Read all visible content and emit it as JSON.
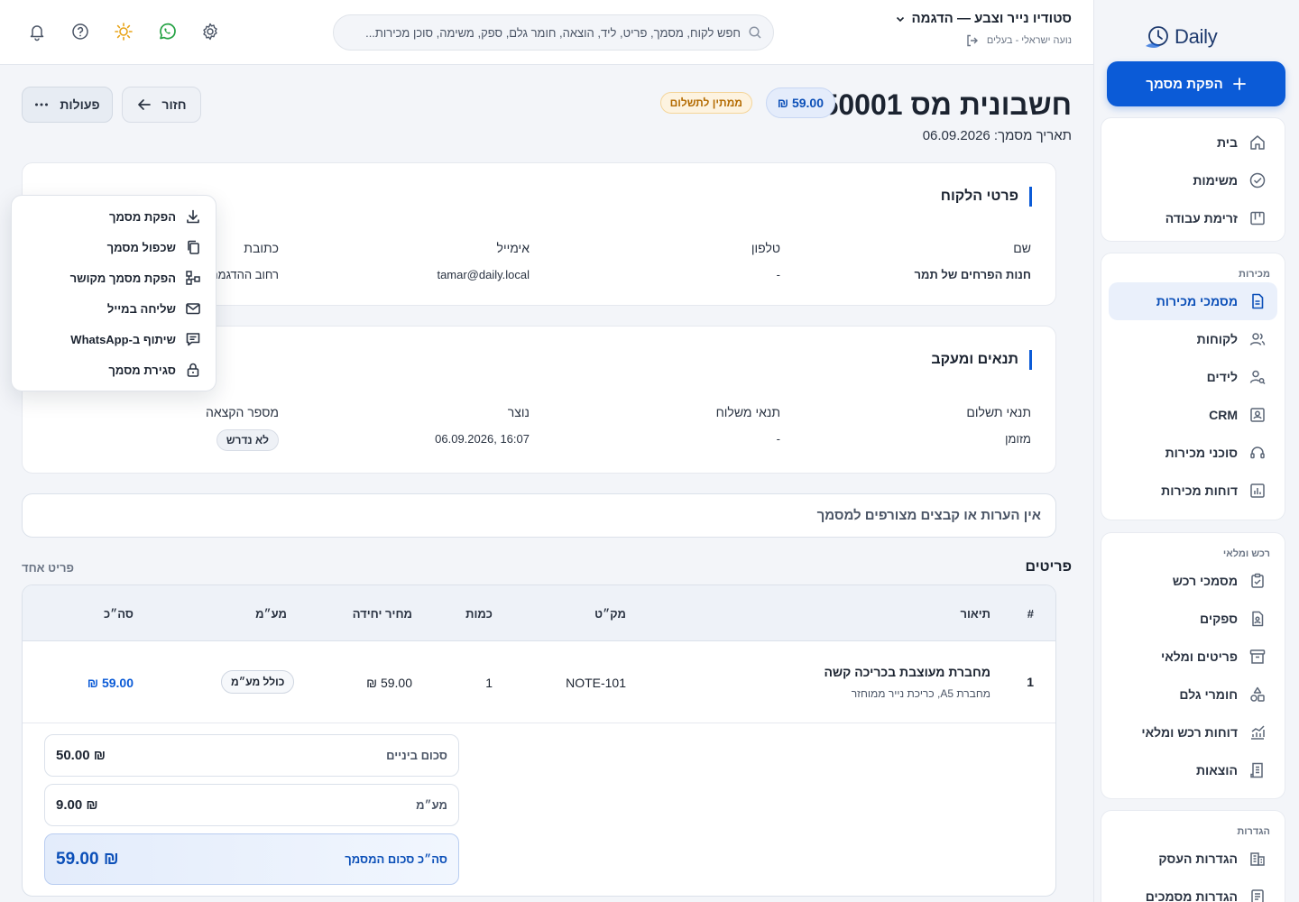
{
  "sidebar": {
    "logo_text": "Daily",
    "new_doc_label": "הפקת מסמך",
    "top_items": [
      {
        "label": "בית",
        "icon": "home-icon"
      },
      {
        "label": "משימות",
        "icon": "check-circle-icon"
      },
      {
        "label": "זרימת עבודה",
        "icon": "kanban-icon"
      }
    ],
    "sales_section": "מכירות",
    "sales_items": [
      {
        "label": "מסמכי מכירות",
        "icon": "document-icon",
        "active": true
      },
      {
        "label": "לקוחות",
        "icon": "users-icon"
      },
      {
        "label": "לידים",
        "icon": "user-search-icon"
      },
      {
        "label": "CRM",
        "icon": "contact-card-icon"
      },
      {
        "label": "סוכני מכירות",
        "icon": "headset-icon"
      },
      {
        "label": "דוחות מכירות",
        "icon": "bar-chart-icon"
      }
    ],
    "stock_section": "רכש ומלאי",
    "stock_items": [
      {
        "label": "מסמכי רכש",
        "icon": "clipboard-icon"
      },
      {
        "label": "ספקים",
        "icon": "supplier-icon"
      },
      {
        "label": "פריטים ומלאי",
        "icon": "archive-icon"
      },
      {
        "label": "חומרי גלם",
        "icon": "shapes-icon"
      },
      {
        "label": "דוחות רכש ומלאי",
        "icon": "line-chart-icon"
      },
      {
        "label": "הוצאות",
        "icon": "receipt-icon"
      }
    ],
    "settings_section": "הגדרות",
    "settings_items": [
      {
        "label": "הגדרות העסק",
        "icon": "building-icon"
      },
      {
        "label": "הגדרות מסמכים",
        "icon": "document-settings-icon"
      }
    ]
  },
  "header": {
    "business_name": "סטודיו נייר וצבע — הדגמה",
    "user_line": "נועה ישראלי - בעלים",
    "search_placeholder": "חפש לקוח, מסמך, פריט, ליד, הוצאה, חומר גלם, ספק, משימה, סוכן מכירות...",
    "icons": [
      "bell-icon",
      "help-icon",
      "sun-icon",
      "whatsapp-icon",
      "gear-icon"
    ]
  },
  "document": {
    "title": "חשבונית מס 50001",
    "amount": "59.00 ₪",
    "status": "ממתין לתשלום",
    "date_line": "תאריך מסמך: 06.09.2026",
    "back_label": "חזור",
    "actions_label": "פעולות"
  },
  "actions_menu": [
    {
      "label": "הפקת מסמך",
      "icon": "download-icon"
    },
    {
      "label": "שכפול מסמך",
      "icon": "copy-icon"
    },
    {
      "label": "הפקת מסמך מקושר",
      "icon": "linked-doc-icon"
    },
    {
      "label": "שליחה במייל",
      "icon": "mail-icon"
    },
    {
      "label": "שיתוף ב-WhatsApp",
      "icon": "message-icon"
    },
    {
      "label": "סגירת מסמך",
      "icon": "lock-icon"
    }
  ],
  "customer": {
    "title": "פרטי הלקוח",
    "name_label": "שם",
    "name": "חנות הפרחים של תמר",
    "phone_label": "טלפון",
    "phone": "-",
    "email_label": "אימייל",
    "email": "tamar@daily.local",
    "address_label": "כתובת",
    "address": "רחוב ההדגמה"
  },
  "terms": {
    "title": "תנאים ומעקב",
    "payment_label": "תנאי תשלום",
    "payment": "מזומן",
    "shipping_label": "תנאי משלוח",
    "shipping": "-",
    "created_label": "נוצר",
    "created": "16:07 ,06.09.2026",
    "allocation_label": "מספר הקצאה",
    "allocation": "לא נדרש"
  },
  "notes_text": "אין הערות או קבצים מצורפים למסמך",
  "items": {
    "title": "פריטים",
    "count_label": "פריט אחד",
    "columns": {
      "num": "#",
      "desc": "תיאור",
      "sku": "מק״ט",
      "qty": "כמות",
      "unit_price": "מחיר יחידה",
      "vat": "מע״מ",
      "total": "סה״כ"
    },
    "rows": [
      {
        "num": "1",
        "desc": "מחברת מעוצבת בכריכה קשה",
        "sub": "מחברת A5, כריכת נייר ממוחזר",
        "sku": "NOTE-101",
        "qty": "1",
        "unit_price": "59.00 ₪",
        "vat": "כולל מע״מ",
        "total": "59.00 ₪"
      }
    ]
  },
  "totals": {
    "subtotal_label": "סכום ביניים",
    "subtotal": "50.00 ₪",
    "vat_label": "מע״מ",
    "vat": "9.00 ₪",
    "grand_label": "סה״כ סכום המסמך",
    "grand": "59.00 ₪"
  },
  "colors": {
    "accent": "#0b5bd7",
    "status": "#b36a00",
    "whatsapp": "#25a244",
    "sun": "#e8a317"
  }
}
